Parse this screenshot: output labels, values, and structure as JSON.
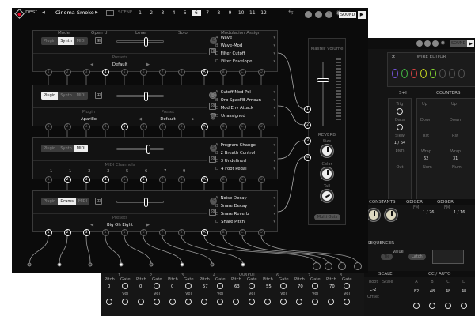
{
  "app": {
    "name": "nest",
    "project": "Cinema Smoke",
    "scene_label": "SCENE",
    "scenes": [
      "1",
      "2",
      "3",
      "4",
      "5",
      "6",
      "7",
      "8",
      "9",
      "10",
      "11",
      "12"
    ],
    "active_scene": "6",
    "sound_label": "SOUND"
  },
  "headers": {
    "mode": "Mode",
    "open_ui": "Open UI",
    "level": "Level",
    "solo": "Solo",
    "mod_assign": "Modulation Assign"
  },
  "solo_label": "S",
  "slots": [
    {
      "modes": [
        "Plugin",
        "Synth",
        "MIDI"
      ],
      "active": 1,
      "level": 0.62,
      "sub": [
        {
          "label": "Presets",
          "value": "Default"
        }
      ],
      "mod": [
        {
          "l": "A",
          "n": "Wave"
        },
        {
          "l": "B",
          "n": "Wave-Mod"
        },
        {
          "l": "C",
          "n": "Filter Cutoff"
        },
        {
          "l": "D",
          "n": "Filter Envelope"
        }
      ],
      "jacks": [
        "1",
        "2",
        "3",
        "4",
        "5",
        "6",
        "7",
        "8"
      ],
      "on": [
        3
      ],
      "mjacks": [
        "A",
        "B",
        "C",
        "D"
      ],
      "mon": [
        0
      ]
    },
    {
      "modes": [
        "Plugin",
        "Synth",
        "MIDI"
      ],
      "active": 0,
      "level": 0.62,
      "sub": [
        {
          "label": "Plugin",
          "value": "Aparillo"
        },
        {
          "label": "Preset",
          "value": "Default"
        }
      ],
      "mod": [
        {
          "l": "A",
          "n": "Cutoff Mod Pol"
        },
        {
          "l": "B",
          "n": "Orb SpacFB Amoun"
        },
        {
          "l": "C",
          "n": "Mod Env Attack"
        },
        {
          "l": "D",
          "n": "Unassigned"
        }
      ],
      "jacks": [
        "1",
        "2",
        "3",
        "4",
        "5",
        "6",
        "7",
        "8"
      ],
      "on": [
        4
      ],
      "mjacks": [
        "A",
        "B",
        "C",
        "D"
      ],
      "mon": [
        0
      ]
    },
    {
      "modes": [
        "Plugin",
        "Synth",
        "MIDI"
      ],
      "active": 2,
      "level": 0.67,
      "sub": [
        {
          "label": "MIDI Channels",
          "value": ""
        }
      ],
      "channels": [
        "1",
        "1",
        "3",
        "3",
        "5",
        "6",
        "7",
        "9"
      ],
      "mod": [
        {
          "l": "A",
          "n": "Program Change"
        },
        {
          "l": "B",
          "n": "2 Breath Control"
        },
        {
          "l": "C",
          "n": "3 Undefined"
        },
        {
          "l": "D",
          "n": "4 Foot Pedal"
        }
      ],
      "jacks": [
        "1",
        "2",
        "3",
        "4",
        "5",
        "6",
        "7",
        "8"
      ],
      "on": [
        1,
        2,
        3,
        5
      ],
      "mjacks": [
        "A",
        "B",
        "C",
        "D"
      ],
      "mon": [
        0
      ]
    },
    {
      "modes": [
        "Plugin",
        "Drums",
        "MIDI"
      ],
      "active": 1,
      "level": 0.62,
      "sub": [
        {
          "label": "Presets",
          "value": "Big Oh Eight"
        }
      ],
      "mod": [
        {
          "l": "A",
          "n": "Noise Decay"
        },
        {
          "l": "B",
          "n": "Snare Decay"
        },
        {
          "l": "C",
          "n": "Snare Reverb"
        },
        {
          "l": "D",
          "n": "Snare Pitch"
        }
      ],
      "jacks": [
        "1",
        "2",
        "3",
        "4",
        "5",
        "6",
        "7",
        "8"
      ],
      "on": [
        0,
        1,
        2
      ],
      "mjacks": [
        "A",
        "B",
        "C",
        "D"
      ],
      "mon": [
        0
      ]
    }
  ],
  "master": {
    "title": "Master Volume",
    "volume": 0.75,
    "outputs": [
      "1",
      "2",
      "3",
      "4"
    ],
    "reverb": "REVERB",
    "size": "Size",
    "color": "Color",
    "tail": "Tail",
    "multi_outs": "Multi Outs"
  },
  "bottom": {
    "output_label": "OUTPUT",
    "outputs": [
      "1",
      "2",
      "3",
      "4",
      "5",
      "6",
      "7",
      "8"
    ],
    "pitch": "Pitch",
    "gate": "Gate",
    "vel": "Vel",
    "pitch_values": [
      "0",
      "0",
      "0",
      "57",
      "63",
      "55",
      "70",
      "70"
    ]
  },
  "right": {
    "wire_editor": "WIRE EDITOR",
    "snh": "S+H",
    "counters": "COUNTERS",
    "trig": "Trig",
    "data": "Data",
    "slew": "Slew",
    "slew_val": "1 / 64",
    "rnd": "RND",
    "out": "Out",
    "up": "Up",
    "down": "Down",
    "rst": "Rst",
    "wrap": "Wrap",
    "wrap_vals": [
      "62",
      "31"
    ],
    "num": "Num",
    "constants": "CONSTANTS",
    "geiger": "GEIGER",
    "fm": "FM",
    "fm_vals": [
      "1 / 26",
      "1 / 16"
    ],
    "sequencer": "SEQUENCER",
    "tie": "Tie",
    "value": "Value",
    "latch": "Latch",
    "scale": "SCALE",
    "root": "Root",
    "scale_btn": "Scale",
    "root_val": "C-2",
    "offset": "Offset",
    "cc_auto": "CC / AUTO",
    "cc": [
      "A",
      "B",
      "C",
      "D"
    ],
    "cc_vals": [
      "82",
      "48",
      "48",
      "48"
    ],
    "wire_colors": [
      "#7755dd",
      "#44bb44",
      "#dd4444",
      "#ccdd22",
      "#88dd33"
    ]
  }
}
